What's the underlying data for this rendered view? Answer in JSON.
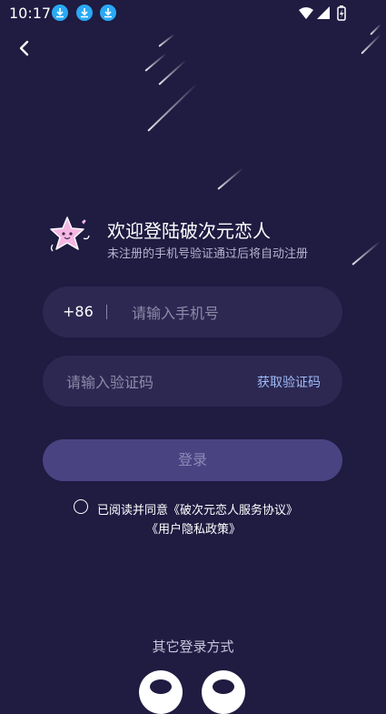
{
  "status_bar": {
    "time": "10:17",
    "icons": [
      "download-icon",
      "download-icon",
      "download-icon",
      "wifi-icon",
      "signal-icon",
      "battery-charging-icon"
    ]
  },
  "nav": {
    "back_icon": "chevron-left-icon"
  },
  "welcome": {
    "title": "欢迎登陆破次元恋人",
    "subtitle": "未注册的手机号验证通过后将自动注册",
    "mascot_icon": "star-mascot-icon"
  },
  "phone": {
    "country_code": "+86",
    "separator": "|",
    "placeholder": "请输入手机号",
    "value": ""
  },
  "code": {
    "placeholder": "请输入验证码",
    "value": "",
    "get_code_label": "获取验证码"
  },
  "login_button": {
    "label": "登录"
  },
  "agreement": {
    "text": "已阅读并同意《破次元恋人服务协议》",
    "privacy": "《用户隐私政策》",
    "checked": false
  },
  "other_login": {
    "label": "其它登录方式"
  },
  "colors": {
    "background": "#1f1b41",
    "field": "#2c2852",
    "button": "#4a4382",
    "link": "#9fbaf7",
    "status_icon": "#2aa9f4"
  }
}
